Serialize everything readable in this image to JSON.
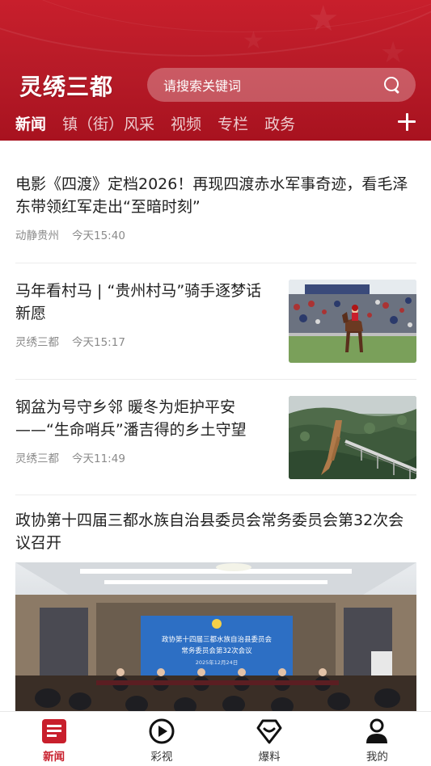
{
  "header": {
    "logo": "灵绣三都",
    "search_placeholder": "请搜索关键词",
    "tabs": [
      {
        "label": "新闻",
        "active": true
      },
      {
        "label": "镇（街）风采",
        "active": false
      },
      {
        "label": "视频",
        "active": false
      },
      {
        "label": "专栏",
        "active": false
      },
      {
        "label": "政务",
        "active": false
      }
    ],
    "brand_color": "#c81f2c"
  },
  "feed": {
    "articles": [
      {
        "title": "电影《四渡》定档2026！再现四渡赤水军事奇迹，看毛泽东带领红军走出“至暗时刻”",
        "source": "动静贵州",
        "time": "今天15:40"
      },
      {
        "title": "马年看村马 | “贵州村马”骑手逐梦话新愿",
        "source": "灵绣三都",
        "time": "今天15:17",
        "thumbnail": "horse-race-photo"
      },
      {
        "title": "钢盆为号守乡邻 暖冬为炬护平安——“生命哨兵”潘吉得的乡土守望",
        "source": "灵绣三都",
        "time": "今天11:49",
        "thumbnail": "mountain-landslide-photo"
      },
      {
        "title": "政协第十四届三都水族自治县委员会常务委员会第32次会议召开",
        "image": "meeting-hall-photo",
        "banner_line1": "政协第十四届三都水族自治县委员会",
        "banner_line2": "常务委员会第32次会议",
        "banner_date": "2025年12月24日"
      }
    ]
  },
  "bottom_nav": {
    "items": [
      {
        "label": "新闻",
        "icon": "news-icon",
        "active": true
      },
      {
        "label": "彩视",
        "icon": "play-icon",
        "active": false
      },
      {
        "label": "爆料",
        "icon": "tip-off-icon",
        "active": false
      },
      {
        "label": "我的",
        "icon": "profile-icon",
        "active": false
      }
    ],
    "active_color": "#c81f2c"
  }
}
